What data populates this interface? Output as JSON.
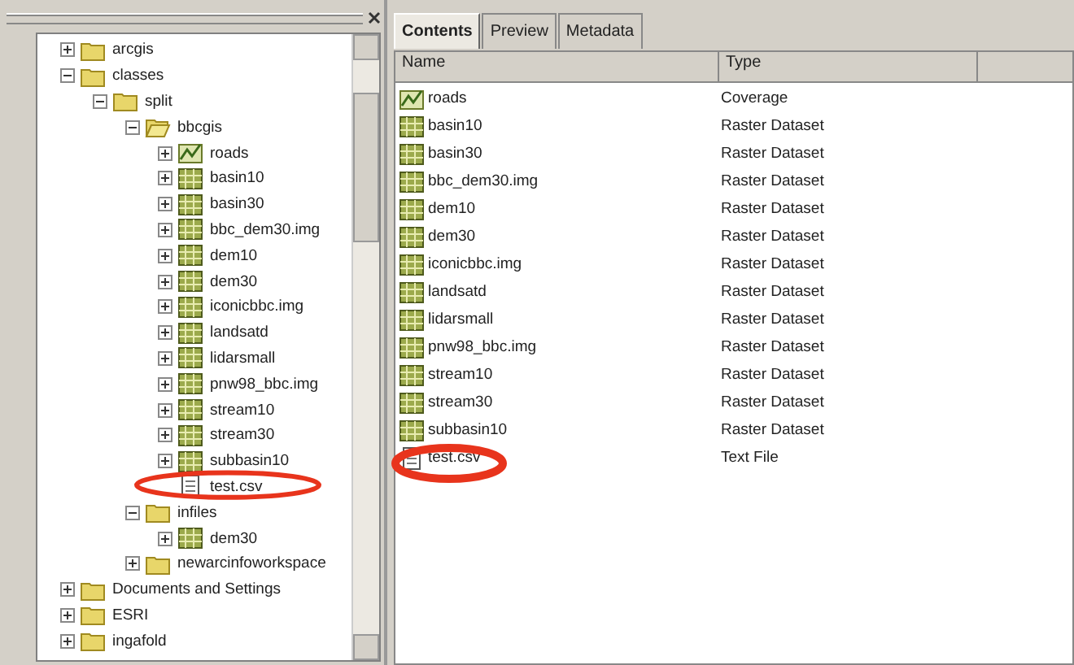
{
  "tree": [
    {
      "label": "arcgis",
      "kind": "folder",
      "expanded": false
    },
    {
      "label": "classes",
      "kind": "folder",
      "expanded": true,
      "children": [
        {
          "label": "split",
          "kind": "folder",
          "expanded": true,
          "children": [
            {
              "label": "bbcgis",
              "kind": "openfolder",
              "expanded": true,
              "children": [
                {
                  "label": "roads",
                  "kind": "coverage",
                  "expanded": false
                },
                {
                  "label": "basin10",
                  "kind": "raster",
                  "expanded": false
                },
                {
                  "label": "basin30",
                  "kind": "raster",
                  "expanded": false
                },
                {
                  "label": "bbc_dem30.img",
                  "kind": "raster",
                  "expanded": false
                },
                {
                  "label": "dem10",
                  "kind": "raster",
                  "expanded": false
                },
                {
                  "label": "dem30",
                  "kind": "raster",
                  "expanded": false
                },
                {
                  "label": "iconicbbc.img",
                  "kind": "raster",
                  "expanded": false
                },
                {
                  "label": "landsatd",
                  "kind": "raster",
                  "expanded": false
                },
                {
                  "label": "lidarsmall",
                  "kind": "raster",
                  "expanded": false
                },
                {
                  "label": "pnw98_bbc.img",
                  "kind": "raster",
                  "expanded": false
                },
                {
                  "label": "stream10",
                  "kind": "raster",
                  "expanded": false
                },
                {
                  "label": "stream30",
                  "kind": "raster",
                  "expanded": false
                },
                {
                  "label": "subbasin10",
                  "kind": "raster",
                  "expanded": false
                },
                {
                  "label": "test.csv",
                  "kind": "file"
                }
              ]
            },
            {
              "label": "infiles",
              "kind": "folder",
              "expanded": true,
              "children": [
                {
                  "label": "dem30",
                  "kind": "raster",
                  "expanded": false
                }
              ]
            },
            {
              "label": "newarcinfoworkspace",
              "kind": "folder",
              "expanded": false
            }
          ]
        }
      ]
    },
    {
      "label": "Documents and Settings",
      "kind": "folder",
      "expanded": false
    },
    {
      "label": "ESRI",
      "kind": "folder",
      "expanded": false
    },
    {
      "label": "ingafold",
      "kind": "folder",
      "expanded": false
    }
  ],
  "tabs": [
    {
      "label": "Contents",
      "selected": true
    },
    {
      "label": "Preview",
      "selected": false
    },
    {
      "label": "Metadata",
      "selected": false
    }
  ],
  "table": {
    "columns": [
      "Name",
      "Type"
    ],
    "rows": [
      {
        "name": "roads",
        "type": "Coverage",
        "kind": "coverage"
      },
      {
        "name": "basin10",
        "type": "Raster Dataset",
        "kind": "raster"
      },
      {
        "name": "basin30",
        "type": "Raster Dataset",
        "kind": "raster"
      },
      {
        "name": "bbc_dem30.img",
        "type": "Raster Dataset",
        "kind": "raster"
      },
      {
        "name": "dem10",
        "type": "Raster Dataset",
        "kind": "raster"
      },
      {
        "name": "dem30",
        "type": "Raster Dataset",
        "kind": "raster"
      },
      {
        "name": "iconicbbc.img",
        "type": "Raster Dataset",
        "kind": "raster"
      },
      {
        "name": "landsatd",
        "type": "Raster Dataset",
        "kind": "raster"
      },
      {
        "name": "lidarsmall",
        "type": "Raster Dataset",
        "kind": "raster"
      },
      {
        "name": "pnw98_bbc.img",
        "type": "Raster Dataset",
        "kind": "raster"
      },
      {
        "name": "stream10",
        "type": "Raster Dataset",
        "kind": "raster"
      },
      {
        "name": "stream30",
        "type": "Raster Dataset",
        "kind": "raster"
      },
      {
        "name": "subbasin10",
        "type": "Raster Dataset",
        "kind": "raster"
      },
      {
        "name": "test.csv",
        "type": "Text File",
        "kind": "file"
      }
    ]
  }
}
